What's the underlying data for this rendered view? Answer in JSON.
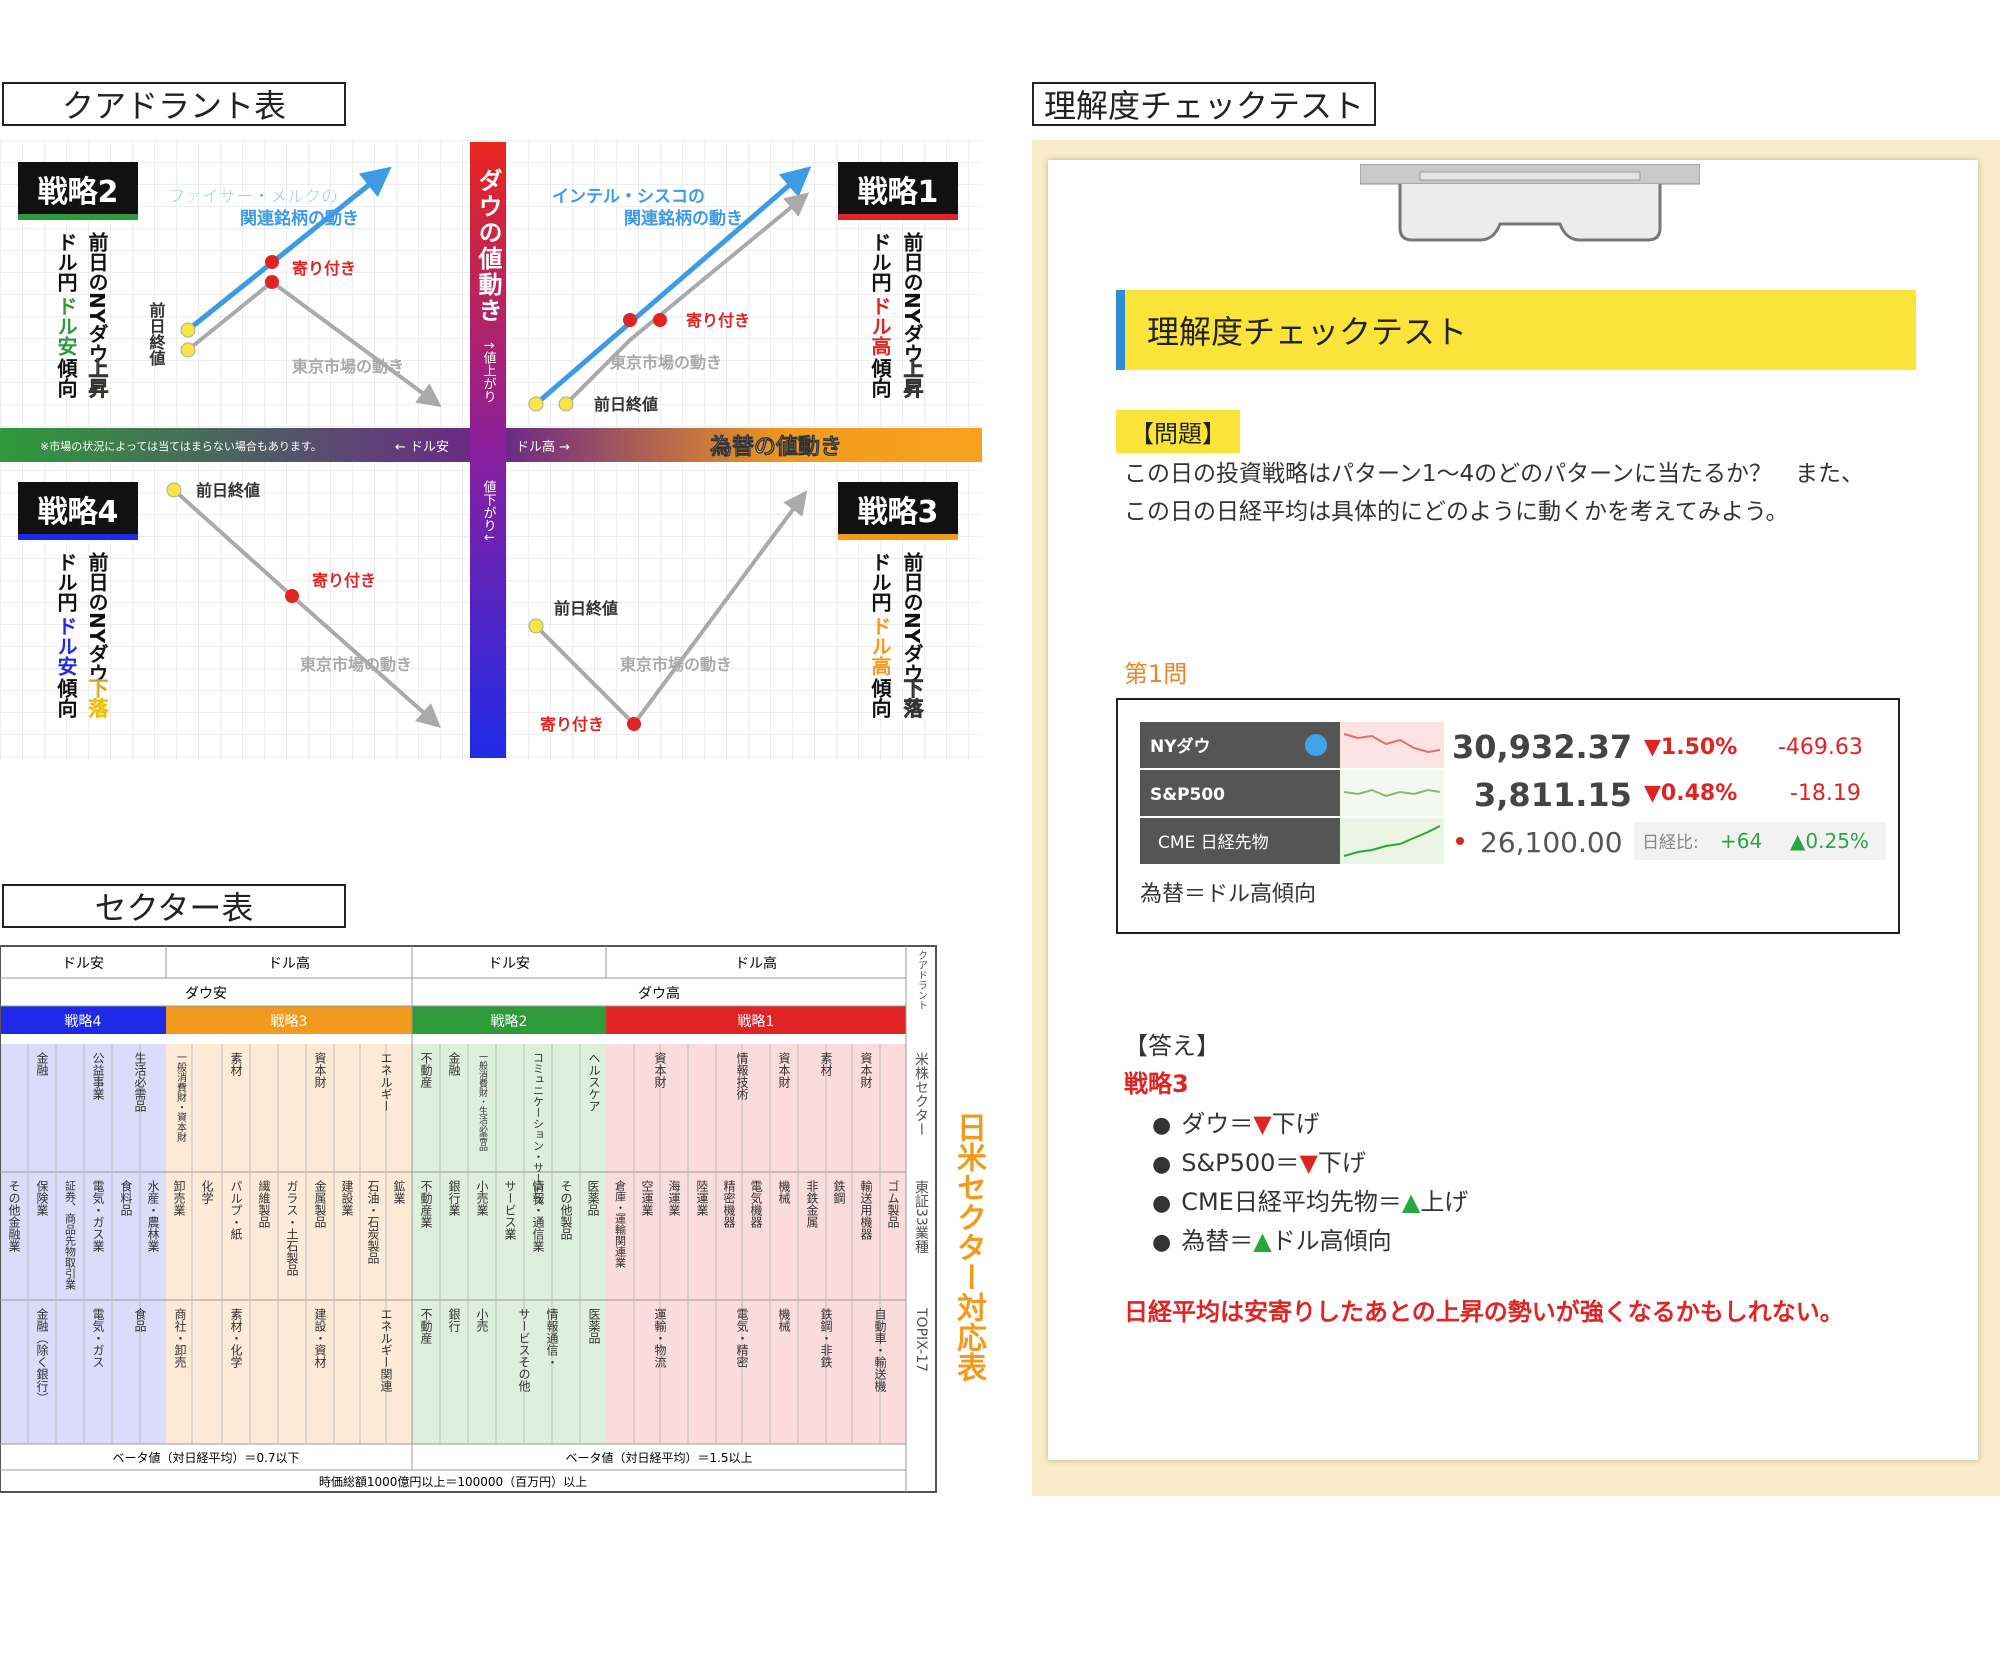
{
  "quadrant": {
    "title": "クアドラント表",
    "vertical_axis_label": "ダウの値動き",
    "up_label": "↑値上がり",
    "down_label": "値下がり↓",
    "horizontal_axis_label": "為替の値動き",
    "dollar_weak": "← ドル安",
    "dollar_strong": "ドル高 →",
    "note": "※市場の状況によっては当てはまらない場合もあります。",
    "strategies": [
      {
        "name": "戦略2",
        "line1_black": "前日のNYダウ",
        "line1_color": "上昇",
        "line2_black": "ドル円",
        "line2_color": "ドル安",
        "line2_tail": "傾向",
        "blue_label_1": "ファイザー・メルクの",
        "blue_label_2": "関連銘柄の動き",
        "open": "寄り付き",
        "prev_close": "前日終値",
        "tokyo": "東京市場の動き"
      },
      {
        "name": "戦略1",
        "line1_black": "前日のNYダウ",
        "line1_color": "上昇",
        "line2_black": "ドル円",
        "line2_color": "ドル高",
        "line2_tail": "傾向",
        "blue_label_1": "インテル・シスコの",
        "blue_label_2": "関連銘柄の動き",
        "open": "寄り付き",
        "prev_close": "前日終値",
        "tokyo": "東京市場の動き"
      },
      {
        "name": "戦略4",
        "line1_black": "前日のNYダウ",
        "line1_color": "下落",
        "line2_black": "ドル円",
        "line2_color": "ドル安",
        "line2_tail": "傾向",
        "open": "寄り付き",
        "prev_close": "前日終値",
        "tokyo": "東京市場の動き"
      },
      {
        "name": "戦略3",
        "line1_black": "前日のNYダウ",
        "line1_color": "下落",
        "line2_black": "ドル円",
        "line2_color": "ドル高",
        "line2_tail": "傾向",
        "open": "寄り付き",
        "prev_close": "前日終値",
        "tokyo": "東京市場の動き"
      }
    ]
  },
  "sector": {
    "title": "セクター表",
    "fx_headers": [
      "ドル安",
      "ドル高",
      "ドル安",
      "ドル高"
    ],
    "dow_headers": [
      "ダウ安",
      "ダウ高"
    ],
    "strategy_headers": [
      "戦略4",
      "戦略3",
      "戦略2",
      "戦略1"
    ],
    "us_sectors": [
      "金融",
      "公益事業",
      "生活必需品",
      "一般消費財・資本財",
      "素材",
      "資本財",
      "エネルギー",
      "不動産",
      "金融",
      "一般消費財・生活必需品",
      "コミュニケーション・サービス",
      "ヘルスケア",
      "資本財",
      "情報技術",
      "資本財",
      "素材",
      "資本財"
    ],
    "tse33": [
      "その他金融業",
      "保険業",
      "証券、商品先物取引業",
      "電気・ガス業",
      "食料品",
      "水産・農林業",
      "卸売業",
      "化学",
      "パルプ・紙",
      "繊維製品",
      "ガラス・土石製品",
      "金属製品",
      "建設業",
      "石油・石炭製品",
      "鉱業",
      "不動産業",
      "銀行業",
      "小売業",
      "サービス業",
      "情報・通信業",
      "その他製品",
      "医薬品",
      "倉庫・運輸関連業",
      "空運業",
      "海運業",
      "陸運業",
      "精密機器",
      "電気機器",
      "機械",
      "非鉄金属",
      "鉄鋼",
      "輸送用機器",
      "ゴム製品"
    ],
    "topix17": [
      "金融（除く銀行）",
      "電気・ガス",
      "食品",
      "商社・卸売",
      "素材・化学",
      "建設・資材",
      "エネルギー関連",
      "不動産",
      "銀行",
      "小売",
      "サービスその他",
      "情報通信・",
      "医薬品",
      "運輸・物流",
      "電気・精密",
      "機械",
      "鉄鋼・非鉄",
      "自動車・輸送機"
    ],
    "side_labels": [
      "クアドラント",
      "米株セクター",
      "東証33業種",
      "TOPIX-17"
    ],
    "big_side_label": "日米セクター対応表",
    "beta_low": "ベータ値（対日経平均）＝0.7以下",
    "beta_high": "ベータ値（対日経平均）＝1.5以上",
    "market_cap": "時価総額1000億円以上＝100000（百万円）以上"
  },
  "test": {
    "outer_title": "理解度チェックテスト",
    "inner_title": "理解度チェックテスト",
    "question_label": "【問題】",
    "question_line1": "この日の投資戦略はパターン1～4のどのパターンに当たるか？　また、",
    "question_line2": "この日の日経平均は具体的にどのように動くかを考えてみよう。",
    "first_question": "第1問",
    "market": {
      "rows": [
        {
          "name": "NYダウ",
          "value": "30,932.37",
          "pct": "▼1.50%",
          "chg": "-469.63"
        },
        {
          "name": "S&P500",
          "value": "3,811.15",
          "pct": "▼0.48%",
          "chg": "-18.19"
        },
        {
          "name": "CME 日経先物",
          "value": "26,100.00",
          "ratio_label": "日経比:",
          "chg": "+64",
          "pct": "▲0.25%"
        }
      ],
      "fx_note": "為替＝ドル高傾向"
    },
    "answer_head": "【答え】",
    "answer_strategy": "戦略3",
    "answers": [
      {
        "pre": "ダウ＝",
        "mark": "▼",
        "post": "下げ",
        "dir": "down"
      },
      {
        "pre": "S&P500＝",
        "mark": "▼",
        "post": "下げ",
        "dir": "down"
      },
      {
        "pre": "CME日経平均先物＝",
        "mark": "▲",
        "post": "上げ",
        "dir": "up"
      },
      {
        "pre": "為替＝",
        "mark": "▲",
        "post": "ドル高傾向",
        "dir": "up"
      }
    ],
    "conclusion": "日経平均は安寄りしたあとの上昇の勢いが強くなるかもしれない。"
  }
}
